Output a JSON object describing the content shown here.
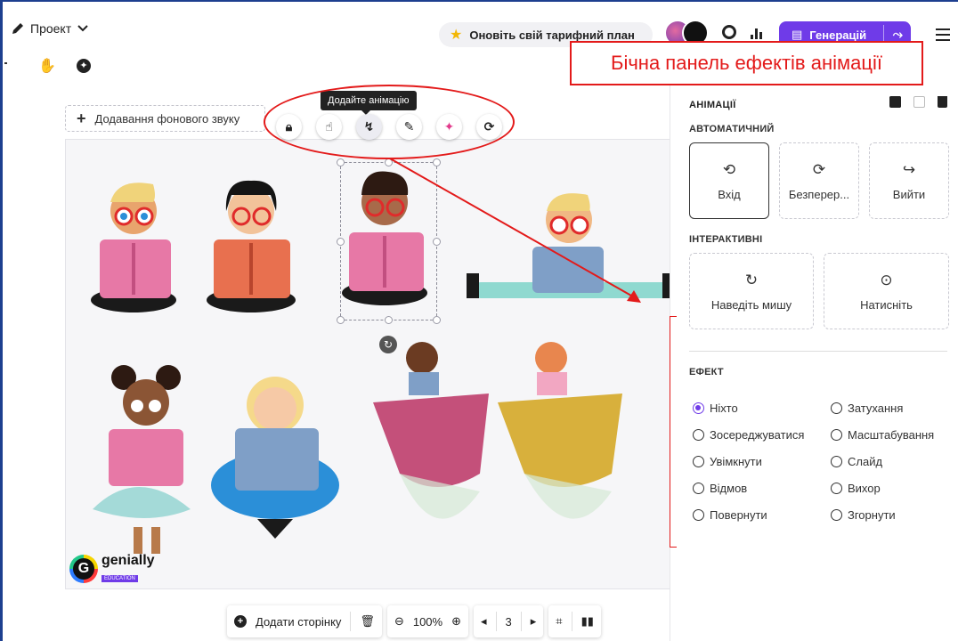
{
  "topbar": {
    "project_label": "Проект",
    "upgrade_label": "Оновіть свій тарифний план",
    "template_button_label": "Генерацій"
  },
  "canvas": {
    "add_sound_label": "Додавання фонового звуку",
    "tooltip": "Додайте анімацію",
    "logo_text": "genially",
    "logo_sub": "EDUCATION"
  },
  "annotation": {
    "label": "Бічна панель ефектів анімації"
  },
  "bottom_bar": {
    "add_page_label": "Додати сторінку",
    "zoom_level": "100%",
    "page_number": "3"
  },
  "panel": {
    "title": "АНІМАЦІЇ",
    "auto_heading": "АВТОМАТИЧНИЙ",
    "auto_options": [
      {
        "label": "Вхід",
        "icon": "enter-icon"
      },
      {
        "label": "Безпереp...",
        "icon": "loop-icon"
      },
      {
        "label": "Вийти",
        "icon": "exit-icon"
      }
    ],
    "interactive_heading": "ІНТЕРАКТИВНІ",
    "interactive_options": [
      {
        "label": "Наведіть мишу",
        "icon": "hover-icon"
      },
      {
        "label": "Натисніть",
        "icon": "click-icon"
      }
    ],
    "effect_heading": "ЕФЕКТ",
    "effects": [
      {
        "label": "Ніхто",
        "selected": true
      },
      {
        "label": "Затухання",
        "selected": false
      },
      {
        "label": "Зосереджуватися",
        "selected": false
      },
      {
        "label": "Масштабування",
        "selected": false
      },
      {
        "label": "Увімкнути",
        "selected": false
      },
      {
        "label": "Слайд",
        "selected": false
      },
      {
        "label": "Відмов",
        "selected": false
      },
      {
        "label": "Вихор",
        "selected": false
      },
      {
        "label": "Повернути",
        "selected": false
      },
      {
        "label": "Згорнути",
        "selected": false
      }
    ]
  },
  "colors": {
    "accent": "#6f3be8",
    "annotation": "#e31a1a"
  }
}
